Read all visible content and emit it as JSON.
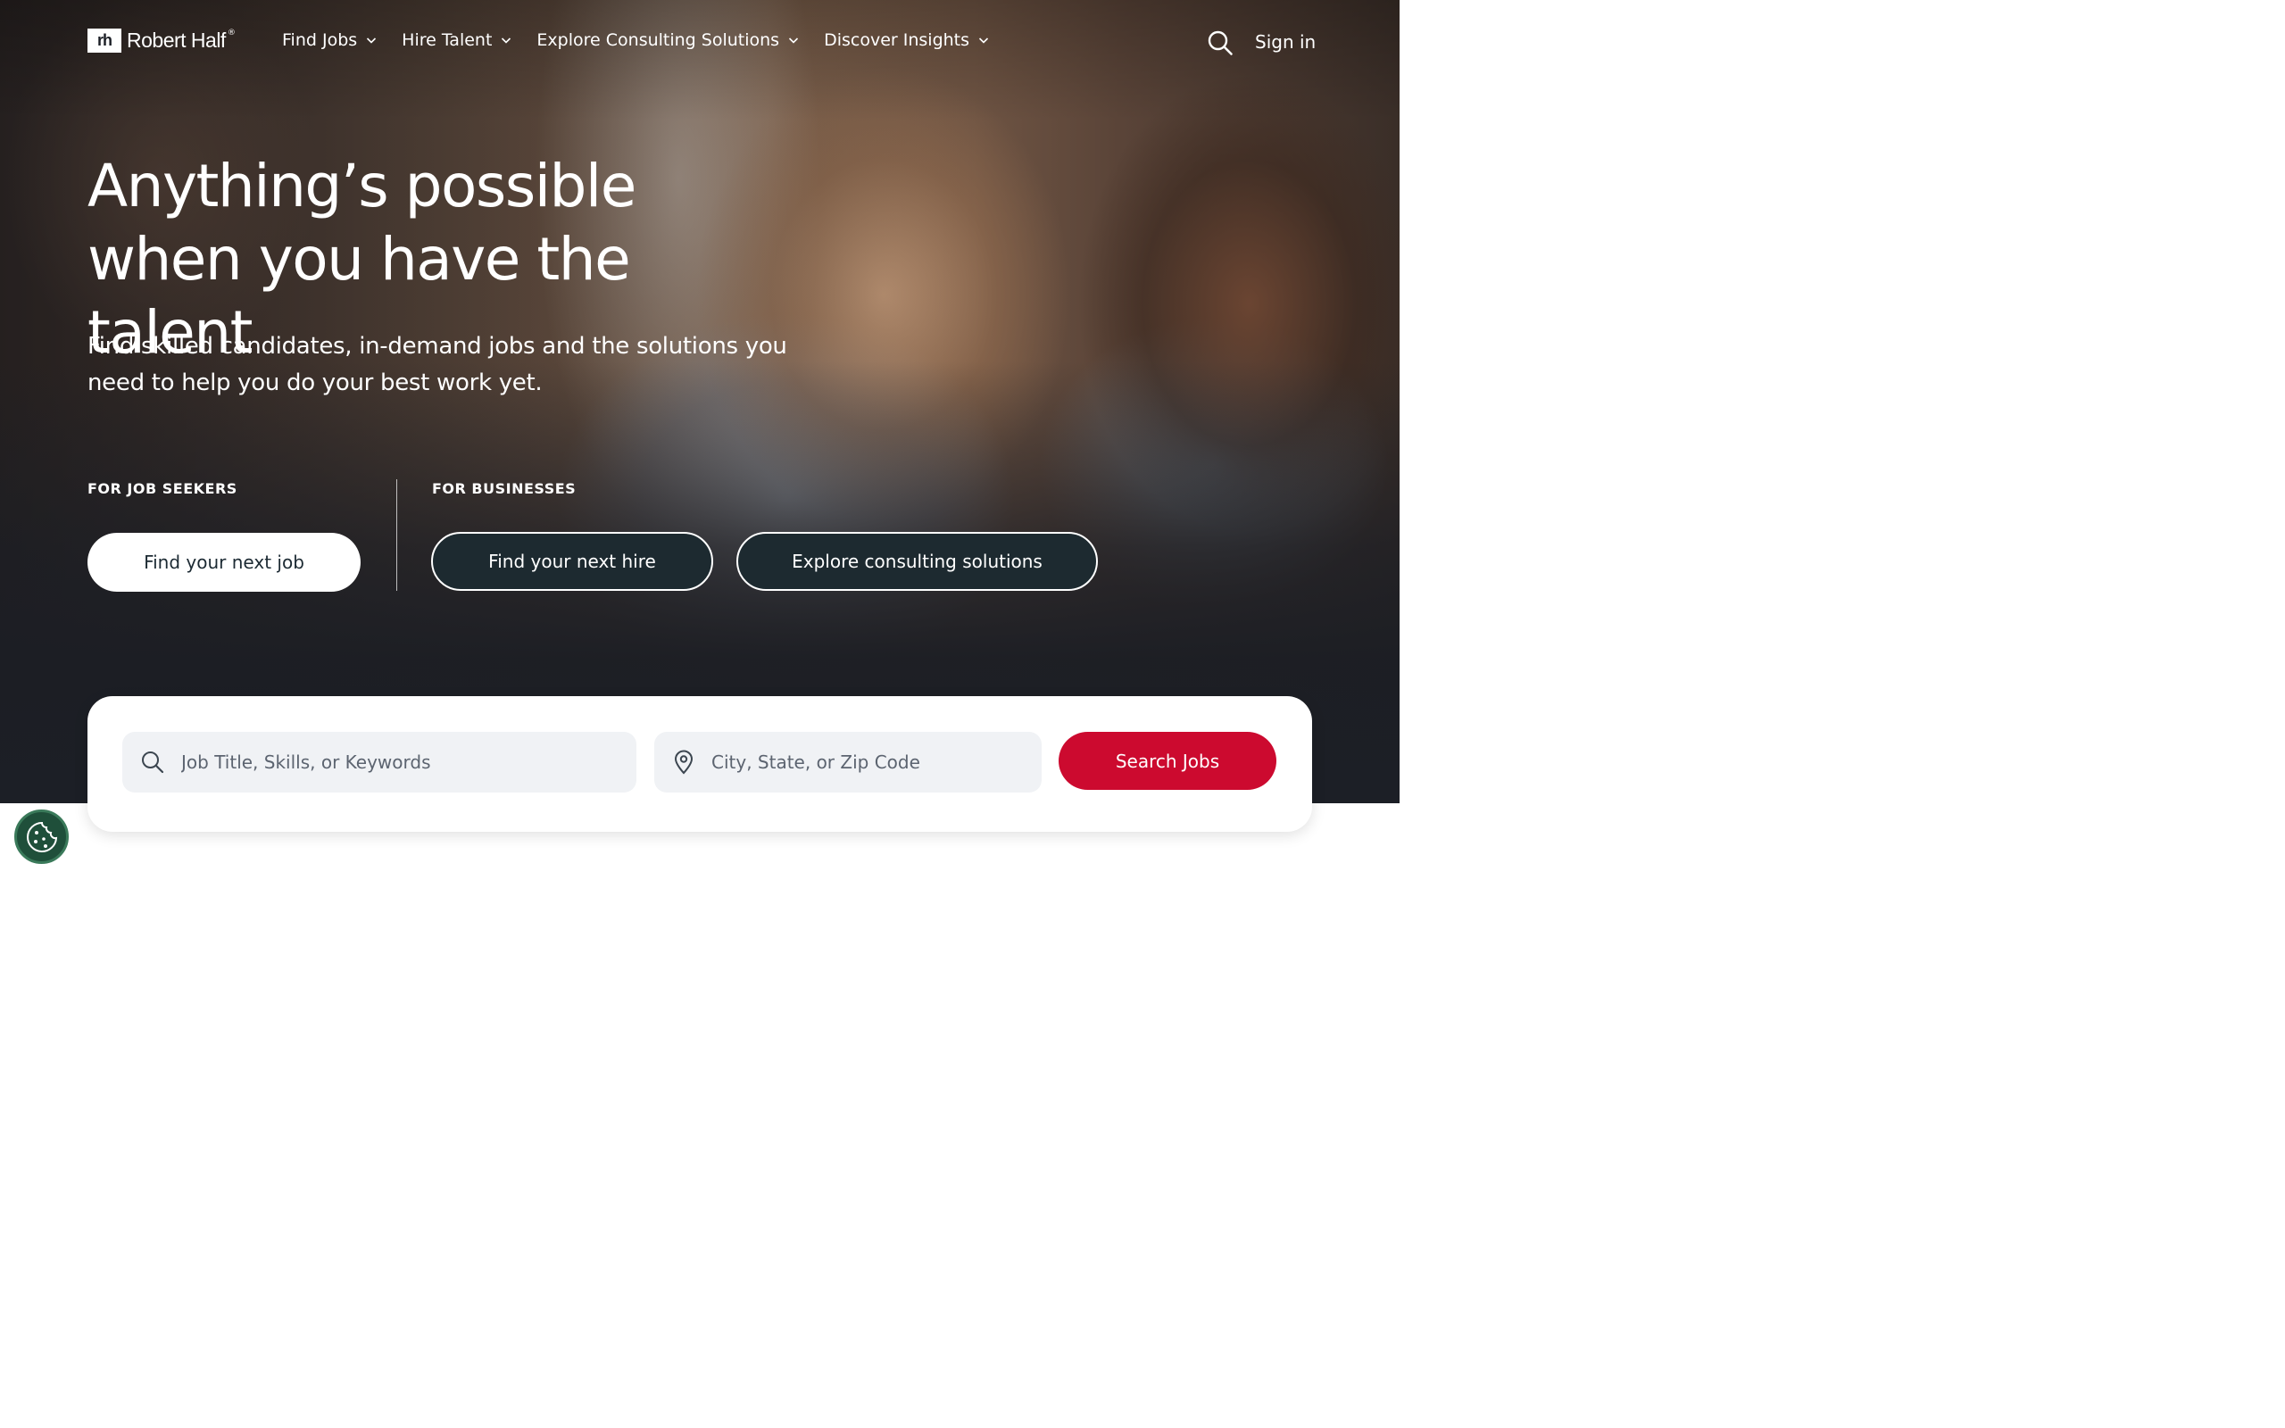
{
  "brand": {
    "logo_mark": "rh",
    "name": "Robert Half",
    "tm": "®"
  },
  "nav": {
    "items": [
      {
        "label": "Find Jobs"
      },
      {
        "label": "Hire Talent"
      },
      {
        "label": "Explore Consulting Solutions"
      },
      {
        "label": "Discover Insights"
      }
    ],
    "search_icon": "search-icon",
    "signin_label": "Sign in"
  },
  "hero": {
    "headline": "Anything’s possible when you have the talent",
    "subhead": "Find skilled candidates, in-demand jobs and the solutions you need to help you do your best work yet.",
    "job_seekers_label": "FOR JOB SEEKERS",
    "businesses_label": "FOR BUSINESSES",
    "buttons": {
      "find_job": "Find your next job",
      "find_hire": "Find your next hire",
      "explore_consulting": "Explore consulting solutions"
    }
  },
  "search": {
    "keywords_placeholder": "Job Title, Skills, or Keywords",
    "location_placeholder": "City, State, or Zip Code",
    "submit_label": "Search Jobs",
    "keywords_icon": "search-icon",
    "location_icon": "location-pin-icon"
  },
  "cookie_icon": "cookie-icon",
  "colors": {
    "accent_red": "#cc0a2f",
    "dark_teal": "#1d2a30",
    "cookie_green": "#1f4f3a"
  }
}
